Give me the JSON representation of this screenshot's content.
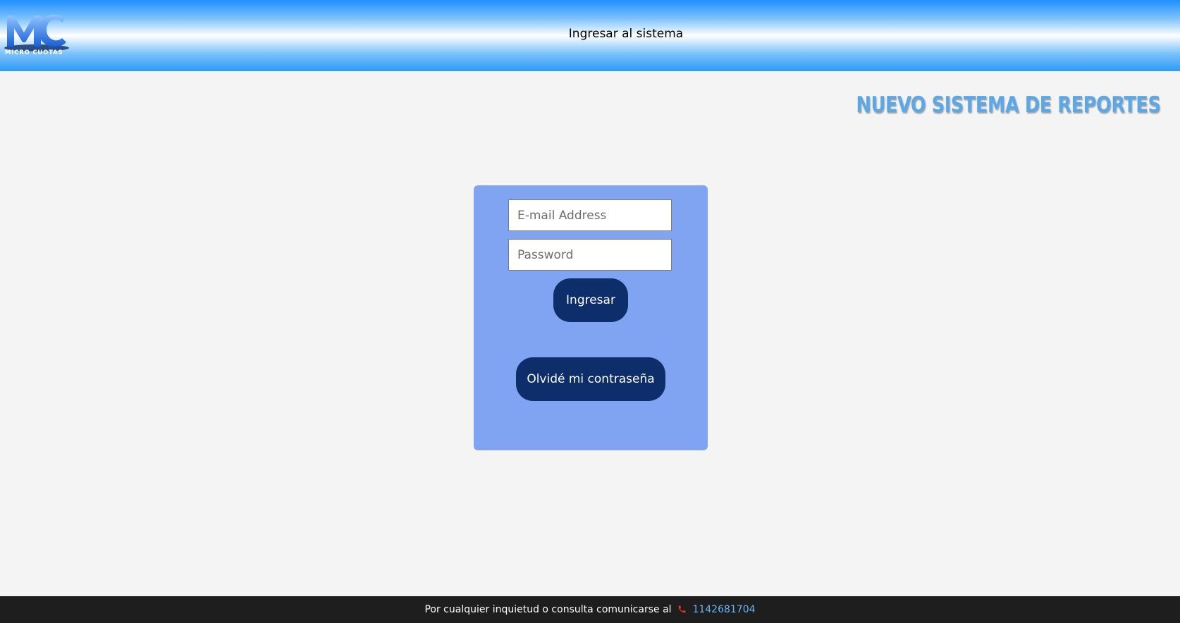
{
  "header": {
    "logo_text": "MICRO CUOTAS",
    "title": "Ingresar al sistema"
  },
  "headline": "NUEVO SISTEMA DE REPORTES",
  "login": {
    "email_placeholder": "E-mail Address",
    "password_placeholder": "Password",
    "login_button": "Ingresar",
    "forgot_button": "Olvidé mi contraseña"
  },
  "footer": {
    "text": "Por cualquier inquietud o consulta comunicarse al",
    "phone": "1142681704",
    "phone_icon": "phone-icon"
  },
  "colors": {
    "card_background": "#80a4f2",
    "button_background": "#0e2d6b",
    "headline": "#5ba8e8",
    "footer_background": "#1e1e1e",
    "phone_link": "#6ab4f4"
  }
}
